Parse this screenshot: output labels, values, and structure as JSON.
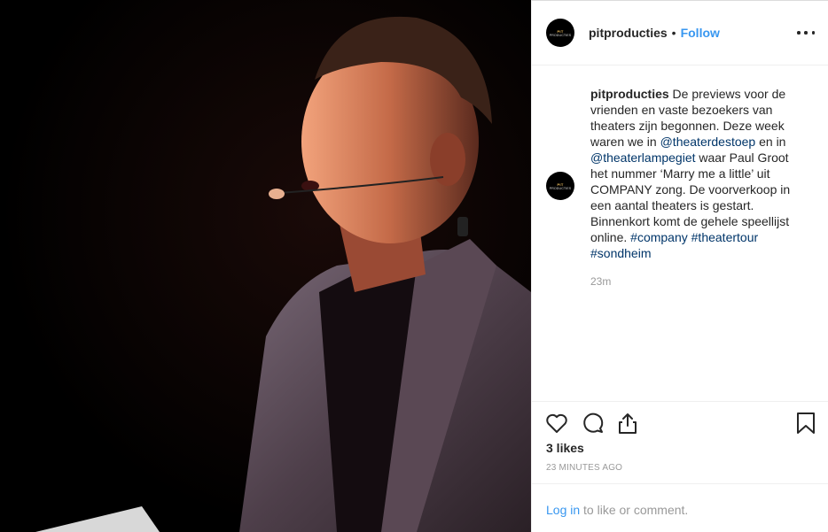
{
  "post": {
    "username": "pitproducties",
    "dot": "•",
    "follow_label": "Follow",
    "more_icon": "more-horizontal-icon",
    "avatar": {
      "line1": "PIT",
      "line2": "PRODUCTIES"
    },
    "caption": {
      "username": "pitproducties",
      "part1": " De previews voor de vrienden en vaste bezoekers van theaters zijn begonnen. Deze week waren we in ",
      "mention1": "@theaterdestoep",
      "part2": " en in ",
      "mention2": "@theaterlampegiet",
      "part3": " waar Paul Groot het nummer ‘Marry me a little’ uit COMPANY zong. De voorverkoop in een aantal theaters is gestart. Binnenkort komt de gehele speellijst online. ",
      "tag1": "#company",
      "tag2": "#theatertour",
      "tag3": "#sondheim",
      "relative_time": "23m"
    },
    "likes": "3 likes",
    "posted": "23 minutes ago",
    "login": {
      "link": "Log in",
      "rest": " to like or comment."
    }
  },
  "icons": [
    "heart-icon",
    "comment-icon",
    "share-icon",
    "bookmark-icon"
  ],
  "colors": {
    "link": "#003569",
    "accent": "#3897f0",
    "muted": "#999999",
    "background": "#000000"
  }
}
